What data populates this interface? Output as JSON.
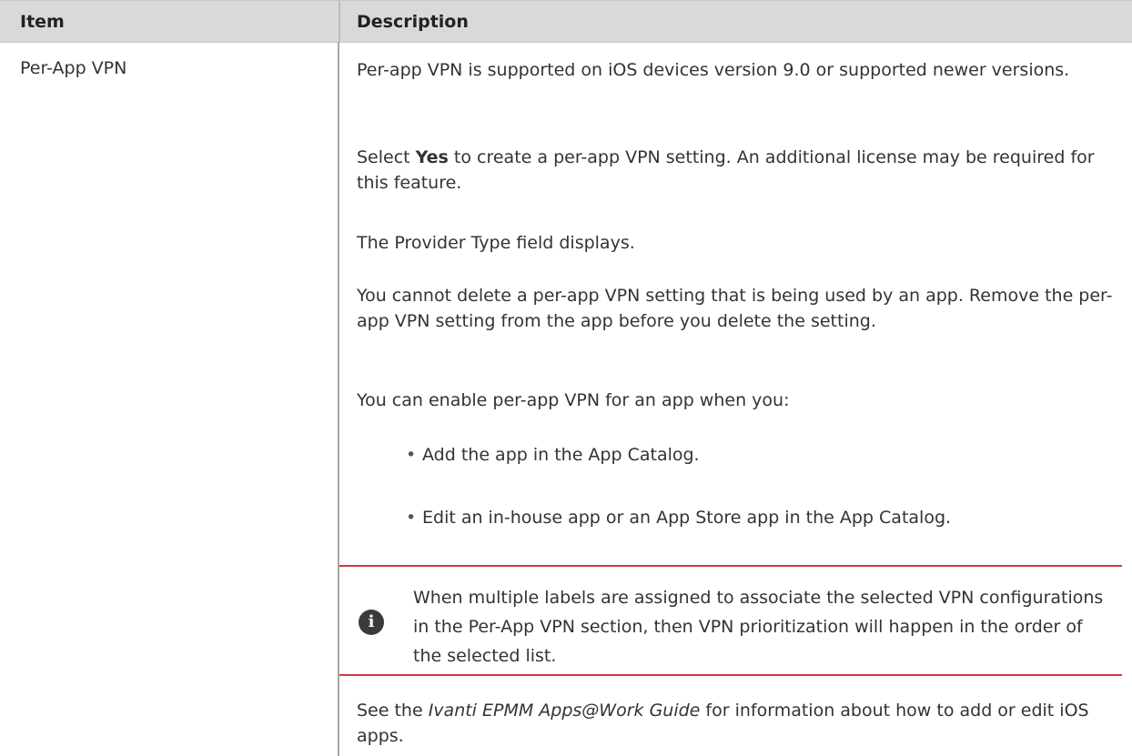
{
  "header": {
    "item": "Item",
    "description": "Description"
  },
  "row": {
    "item": "Per-App VPN",
    "p1": "Per-app VPN is supported on iOS devices version 9.0 or supported newer versions.",
    "p2_prefix": "Select ",
    "p2_bold": "Yes",
    "p2_suffix": " to create a per-app VPN setting. An additional license may be required for this feature.",
    "p3": "The Provider Type field displays.",
    "p4": "You cannot delete a per-app VPN setting that is being used by an app. Remove the per-app VPN setting from the app before you delete the setting.",
    "p5": "You can enable per-app VPN for an app when you:",
    "bullets": [
      "Add the app in the App Catalog.",
      "Edit an in-house app or an App Store app in the App Catalog."
    ],
    "note": {
      "icon": "info-icon",
      "text": "When multiple labels are assigned to associate the selected VPN configurations in the Per-App VPN section, then VPN prioritization will happen in the order of the selected list."
    },
    "see_prefix": "See the ",
    "see_italic": "Ivanti EPMM Apps@Work Guide",
    "see_suffix": " for information about how to add or edit iOS apps."
  },
  "colors": {
    "header_bg": "#d9d9d9",
    "note_rule": "#d13a3a",
    "text": "#333333"
  }
}
